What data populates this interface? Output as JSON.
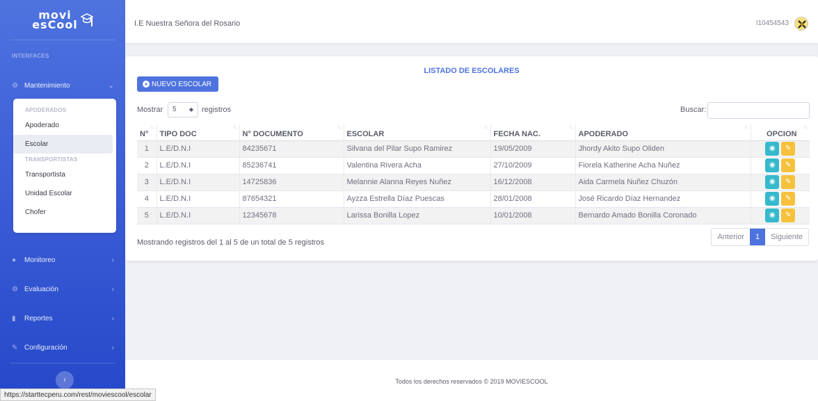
{
  "brand": {
    "line1": "movi",
    "line2": "esCool"
  },
  "sidebar": {
    "heading": "INTERFACES",
    "items": [
      {
        "label": "Mantenimiento"
      },
      {
        "label": "Monitoreo"
      },
      {
        "label": "Evaluación"
      },
      {
        "label": "Reportes"
      },
      {
        "label": "Configuración"
      }
    ],
    "submenu": {
      "heading1": "APODERADOS",
      "heading2": "TRANSPORTISTAS",
      "items": [
        "Apoderado",
        "Escolar",
        "Transportista",
        "Unidad Escolar",
        "Chofer"
      ]
    }
  },
  "topbar": {
    "school": "I.E Nuestra Señora del Rosario",
    "user": "I10454543"
  },
  "card": {
    "title": "LISTADO DE ESCOLARES",
    "new_button": "NUEVO ESCOLAR",
    "show_label": "Mostrar",
    "show_value": "5",
    "records_label": "registros",
    "search_label": "Buscar:",
    "columns": [
      "N°",
      "TIPO DOC",
      "N° DOCUMENTO",
      "ESCOLAR",
      "FECHA NAC.",
      "APODERADO",
      "OPCION"
    ],
    "rows": [
      [
        "1",
        "L.E/D.N.I",
        "84235671",
        "Silvana del Pilar Supo Ramirez",
        "19/05/2009",
        "Jhordy Akito Supo Oliden"
      ],
      [
        "2",
        "L.E/D.N.I",
        "85236741",
        "Valentina Rivera Acha",
        "27/10/2009",
        "Fiorela Katherine Acha Nuñez"
      ],
      [
        "3",
        "L.E/D.N.I",
        "14725836",
        "Melannie Alanna Reyes Nuñez",
        "16/12/2008",
        "Aida Carmela Nuñez Chuzón"
      ],
      [
        "4",
        "L.E/D.N.I",
        "87654321",
        "Ayzza Estrella Díaz Puescas",
        "28/01/2008",
        "José Ricardo Díaz Hernandez"
      ],
      [
        "5",
        "L.E/D.N.I",
        "12345678",
        "Larissa Bonilla Lopez",
        "10/01/2008",
        "Bernardo Amado Bonilla Coronado"
      ]
    ],
    "info": "Mostrando registros del 1 al 5 de un total de 5 registros",
    "pager": {
      "prev": "Anterior",
      "page": "1",
      "next": "Siguiente"
    }
  },
  "footer": "Todos los derechos reservados © 2019 MOVIESCOOL",
  "status_url": "https://starttecperu.com/rest/moviescool/escolar",
  "colors": {
    "primary": "#4e73df",
    "info": "#36b9cc",
    "warning": "#f6c23e"
  }
}
